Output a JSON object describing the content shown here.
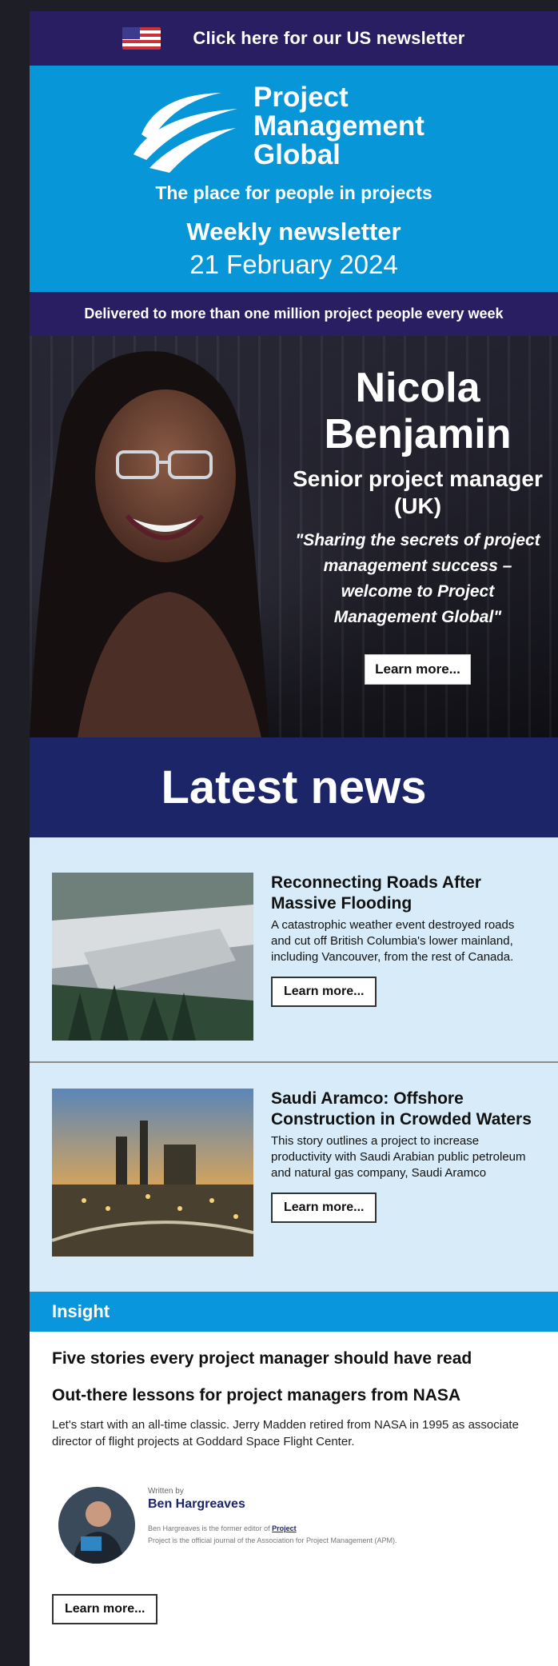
{
  "us_bar": {
    "link_text": "Click here for our US newsletter"
  },
  "masthead": {
    "logo_lines": [
      "Project",
      "Management",
      "Global"
    ],
    "tagline": "The place for people in projects",
    "newsletter_label": "Weekly newsletter",
    "date": "21 February 2024"
  },
  "delivered": {
    "prefix": "Delivered to more than",
    "emphasis": "one million",
    "suffix": "project people every week"
  },
  "hero": {
    "name_line1": "Nicola",
    "name_line2": "Benjamin",
    "role": "Senior project manager (UK)",
    "quote": "\"Sharing the secrets of project management success – welcome to Project Management Global\"",
    "button": "Learn more..."
  },
  "latest": {
    "heading": "Latest news"
  },
  "stories": [
    {
      "title": "Reconnecting Roads After Massive Flooding",
      "desc": "A catastrophic weather event destroyed roads and cut off British Columbia's lower mainland, including Vancouver, from the rest of Canada.",
      "button": "Learn more..."
    },
    {
      "title": "Saudi Aramco: Offshore Construction in Crowded Waters",
      "desc": "This story outlines a project to increase productivity with Saudi Arabian public petroleum and natural gas company, Saudi Aramco",
      "button": "Learn more..."
    }
  ],
  "insight": {
    "bar_label": "Insight",
    "headline1": "Five stories every project manager should have read",
    "headline2": "Out-there lessons for project managers from NASA",
    "text": "Let's start with an all-time classic. Jerry Madden retired from NASA in 1995 as associate director of flight projects at Goddard Space Flight Center.",
    "written_by": "Written by",
    "author_name": "Ben Hargreaves",
    "bio_line1_prefix": "Ben Hargreaves is the former editor of",
    "bio_line1_link": "Project",
    "bio_line2": "Project is the official journal of the Association for Project Management (APM).",
    "button": "Learn more..."
  },
  "colors": {
    "navy": "#2a1e63",
    "brand_blue": "#0796d8",
    "latest_navy": "#1b2568",
    "news_bg": "#d7ebf8"
  }
}
